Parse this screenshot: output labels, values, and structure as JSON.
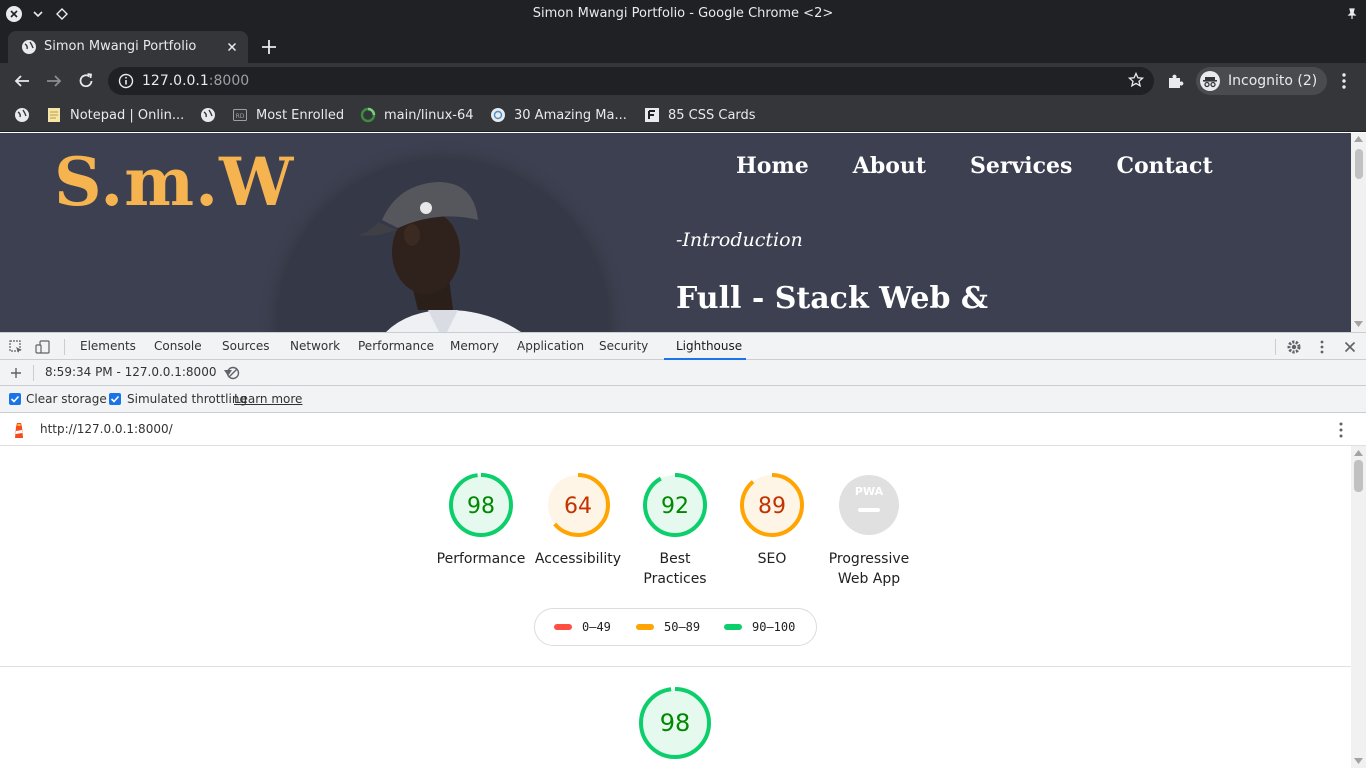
{
  "window": {
    "title": "Simon Mwangi Portfolio - Google Chrome <2>"
  },
  "tab": {
    "title": "Simon Mwangi Portfolio"
  },
  "omnibox": {
    "host": "127.0.0.1",
    "port": ":8000"
  },
  "profile": {
    "label": "Incognito (2)"
  },
  "bookmarks": [
    {
      "label": "Notepad | Onlin...",
      "icon": "notepad-icon"
    },
    {
      "label": "Most Enrolled",
      "icon": "rd-icon"
    },
    {
      "label": "main/linux-64",
      "icon": "loading-icon"
    },
    {
      "label": "30 Amazing Ma...",
      "icon": "site-icon"
    },
    {
      "label": "85 CSS Cards",
      "icon": "f-icon"
    }
  ],
  "site": {
    "logo": "S.m.W",
    "nav": [
      "Home",
      "About",
      "Services",
      "Contact"
    ],
    "intro": "-Introduction",
    "headline": "Full - Stack Web &"
  },
  "devtools": {
    "tabs": [
      "Elements",
      "Console",
      "Sources",
      "Network",
      "Performance",
      "Memory",
      "Application",
      "Security",
      "Lighthouse"
    ],
    "active_tab": "Lighthouse",
    "report_select": "8:59:34 PM - 127.0.0.1:8000",
    "clear_storage": "Clear storage",
    "simulated_throttling": "Simulated throttling",
    "learn_more": "Learn more",
    "report_url": "http://127.0.0.1:8000/"
  },
  "lighthouse": {
    "colors": {
      "pass": "#0cce6b",
      "average": "#ffa400",
      "fail": "#ff4e42",
      "na": "#e0e0e0"
    },
    "categories": [
      {
        "score": "98",
        "label": "Performance",
        "value": 98,
        "rating": "pass"
      },
      {
        "score": "64",
        "label": "Accessibility",
        "value": 64,
        "rating": "average"
      },
      {
        "score": "92",
        "label": "Best Practices",
        "value": 92,
        "rating": "pass"
      },
      {
        "score": "89",
        "label": "SEO",
        "value": 89,
        "rating": "average"
      },
      {
        "score": "",
        "label": "Progressive Web App",
        "value": 0,
        "rating": "na",
        "badge": "PWA"
      }
    ],
    "legend": [
      {
        "label": "0–49",
        "rating": "fail"
      },
      {
        "label": "50–89",
        "rating": "average"
      },
      {
        "label": "90–100",
        "rating": "pass"
      }
    ],
    "section_score": {
      "score": "98",
      "value": 98,
      "rating": "pass"
    }
  }
}
